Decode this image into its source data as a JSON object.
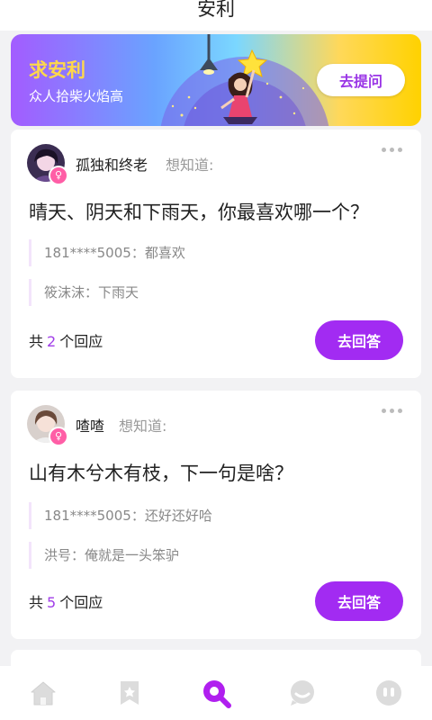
{
  "page": {
    "title": "安利"
  },
  "banner": {
    "title": "求安利",
    "subtitle": "众人拾柴火焰高",
    "button_label": "去提问",
    "colors": {
      "title": "#ffd84a",
      "button_text": "#9a35e6"
    }
  },
  "posts": [
    {
      "user_name": "孤独和终老",
      "asks_label": "想知道:",
      "question": "晴天、阴天和下雨天，你最喜欢哪一个？",
      "replies": [
        {
          "author": "181****5005",
          "sep": "：",
          "text": "都喜欢"
        },
        {
          "author": "筱沫沫",
          "sep": "：",
          "text": "下雨天"
        }
      ],
      "count_prefix": "共",
      "count": "2",
      "count_suffix": "个回应",
      "answer_label": "去回答",
      "avatar_icon": "user-avatar-female",
      "gender_icon": "female-icon"
    },
    {
      "user_name": "喳喳",
      "asks_label": "想知道:",
      "question": "山有木兮木有枝，下一句是啥？",
      "replies": [
        {
          "author": "181****5005",
          "sep": "：",
          "text": "还好还好哈"
        },
        {
          "author": "洪号",
          "sep": "：",
          "text": "俺就是一头笨驴"
        }
      ],
      "count_prefix": "共",
      "count": "5",
      "count_suffix": "个回应",
      "answer_label": "去回答",
      "avatar_icon": "user-avatar-female",
      "gender_icon": "female-icon"
    }
  ],
  "tabbar": {
    "items": [
      {
        "icon": "home-icon",
        "active": false
      },
      {
        "icon": "bookmark-star-icon",
        "active": false
      },
      {
        "icon": "question-search-icon",
        "active": true
      },
      {
        "icon": "chat-bubble-icon",
        "active": false
      },
      {
        "icon": "profile-icon",
        "active": false
      }
    ],
    "colors": {
      "active": "#b01fef",
      "inactive": "#d9d9d9"
    }
  },
  "colors": {
    "accent": "#a22bf2",
    "count": "#a03de8"
  }
}
